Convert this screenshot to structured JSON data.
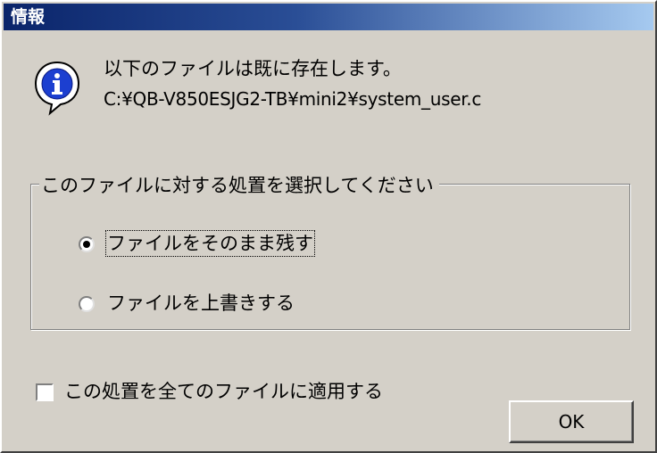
{
  "window": {
    "title": "情報"
  },
  "message": {
    "line1": "以下のファイルは既に存在します。",
    "line2": "C:¥QB-V850ESJG2-TB¥mini2¥system_user.c",
    "icon": "info-icon"
  },
  "group": {
    "legend": "このファイルに対する処置を選択してください",
    "options": [
      {
        "label": "ファイルをそのまま残す",
        "selected": true
      },
      {
        "label": "ファイルを上書きする",
        "selected": false
      }
    ]
  },
  "apply_all": {
    "label": "この処置を全てのファイルに適用する",
    "checked": false
  },
  "buttons": {
    "ok": "OK"
  },
  "colors": {
    "title_start": "#0a246a",
    "title_end": "#a6caf0",
    "face": "#d4d0c8"
  }
}
